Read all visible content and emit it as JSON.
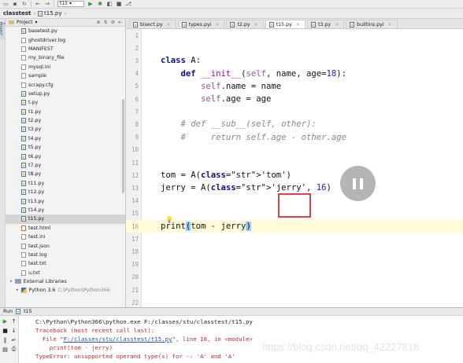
{
  "toolbar": {
    "run_config": "t15",
    "icons": [
      "folder-open-icon",
      "save-icon",
      "sync-icon",
      "back-icon",
      "forward-icon",
      "run-icon",
      "debug-icon",
      "coverage-icon",
      "stop-icon",
      "vcs-icon"
    ]
  },
  "breadcrumbs": {
    "project": "classtest",
    "file": "t15.py"
  },
  "project_panel": {
    "title": "Project",
    "side_label": "1: Project",
    "files": [
      {
        "name": "basetest.py",
        "type": "py"
      },
      {
        "name": "ghostdriver.log",
        "type": "log"
      },
      {
        "name": "MANIFEST",
        "type": "none"
      },
      {
        "name": "my_binary_file",
        "type": "none"
      },
      {
        "name": "mysql.ini",
        "type": "ini"
      },
      {
        "name": "sample",
        "type": "none"
      },
      {
        "name": "scrapy.cfg",
        "type": "cfg"
      },
      {
        "name": "setup.py",
        "type": "py"
      },
      {
        "name": "t.py",
        "type": "py"
      },
      {
        "name": "t1.py",
        "type": "py"
      },
      {
        "name": "t2.py",
        "type": "py"
      },
      {
        "name": "t3.py",
        "type": "py"
      },
      {
        "name": "t4.py",
        "type": "py"
      },
      {
        "name": "t5.py",
        "type": "py"
      },
      {
        "name": "t6.py",
        "type": "py"
      },
      {
        "name": "t7.py",
        "type": "py"
      },
      {
        "name": "t8.py",
        "type": "py"
      },
      {
        "name": "t11.py",
        "type": "py"
      },
      {
        "name": "t12.py",
        "type": "py"
      },
      {
        "name": "t13.py",
        "type": "py"
      },
      {
        "name": "t14.py",
        "type": "py"
      },
      {
        "name": "t15.py",
        "type": "py",
        "selected": true
      },
      {
        "name": "test.html",
        "type": "html"
      },
      {
        "name": "test.ini",
        "type": "ini"
      },
      {
        "name": "test.json",
        "type": "json"
      },
      {
        "name": "test.log",
        "type": "log"
      },
      {
        "name": "test.txt",
        "type": "txt"
      },
      {
        "name": "u.txt",
        "type": "txt"
      }
    ],
    "external_libraries": "External Libraries",
    "python_sdk": "Python 3.6",
    "python_path": "C:\\Python\\Python366"
  },
  "tabs": [
    {
      "label": "bisect.py",
      "active": false
    },
    {
      "label": "types.pyi",
      "active": false
    },
    {
      "label": "t2.py",
      "active": false
    },
    {
      "label": "t15.py",
      "active": true
    },
    {
      "label": "t3.py",
      "active": false
    },
    {
      "label": "builtins.pyi",
      "active": false
    }
  ],
  "editor": {
    "lines": [
      {
        "n": "1",
        "code": ""
      },
      {
        "n": "2",
        "code": ""
      },
      {
        "n": "3",
        "code": "class A:"
      },
      {
        "n": "4",
        "code": "    def __init__(self, name, age=18):"
      },
      {
        "n": "5",
        "code": "        self.name = name"
      },
      {
        "n": "6",
        "code": "        self.age = age"
      },
      {
        "n": "7",
        "code": ""
      },
      {
        "n": "8",
        "code": "    # def __sub__(self, other):"
      },
      {
        "n": "9",
        "code": "    #     return self.age - other.age"
      },
      {
        "n": "10",
        "code": ""
      },
      {
        "n": "11",
        "code": ""
      },
      {
        "n": "12",
        "code": "tom = A('tom')"
      },
      {
        "n": "13",
        "code": "jerry = A('jerry', 16)"
      },
      {
        "n": "14",
        "code": ""
      },
      {
        "n": "15",
        "code": ""
      },
      {
        "n": "16",
        "code": "print(tom - jerry)"
      },
      {
        "n": "17",
        "code": ""
      },
      {
        "n": "18",
        "code": ""
      },
      {
        "n": "19",
        "code": ""
      },
      {
        "n": "20",
        "code": ""
      },
      {
        "n": "21",
        "code": ""
      },
      {
        "n": "22",
        "code": ""
      }
    ],
    "current_line": "16"
  },
  "run_panel": {
    "label": "Run",
    "config": "t15",
    "output": {
      "cmd": "C:\\Python\\Python366\\python.exe F:/classes/stu/classtest/t15.py",
      "traceback": "Traceback (most recent call last):",
      "file_prefix": "  File \"",
      "file_link": "F:/classes/stu/classtest/t15.py",
      "file_suffix": "\", line 16, in <module>",
      "code": "    print(tom - jerry)",
      "error": "TypeError: unsupported operand type(s) for -: 'A' and 'A'"
    }
  },
  "watermark": "https://blog.csdn.net/qq_42227818",
  "colors": {
    "keyword": "#0d0d8a",
    "string": "#0a7f0a",
    "number": "#1c1cd6",
    "self": "#94558d",
    "comment": "#888888",
    "annotation_box": "#e73f3f",
    "current_line": "#fefcd9"
  }
}
